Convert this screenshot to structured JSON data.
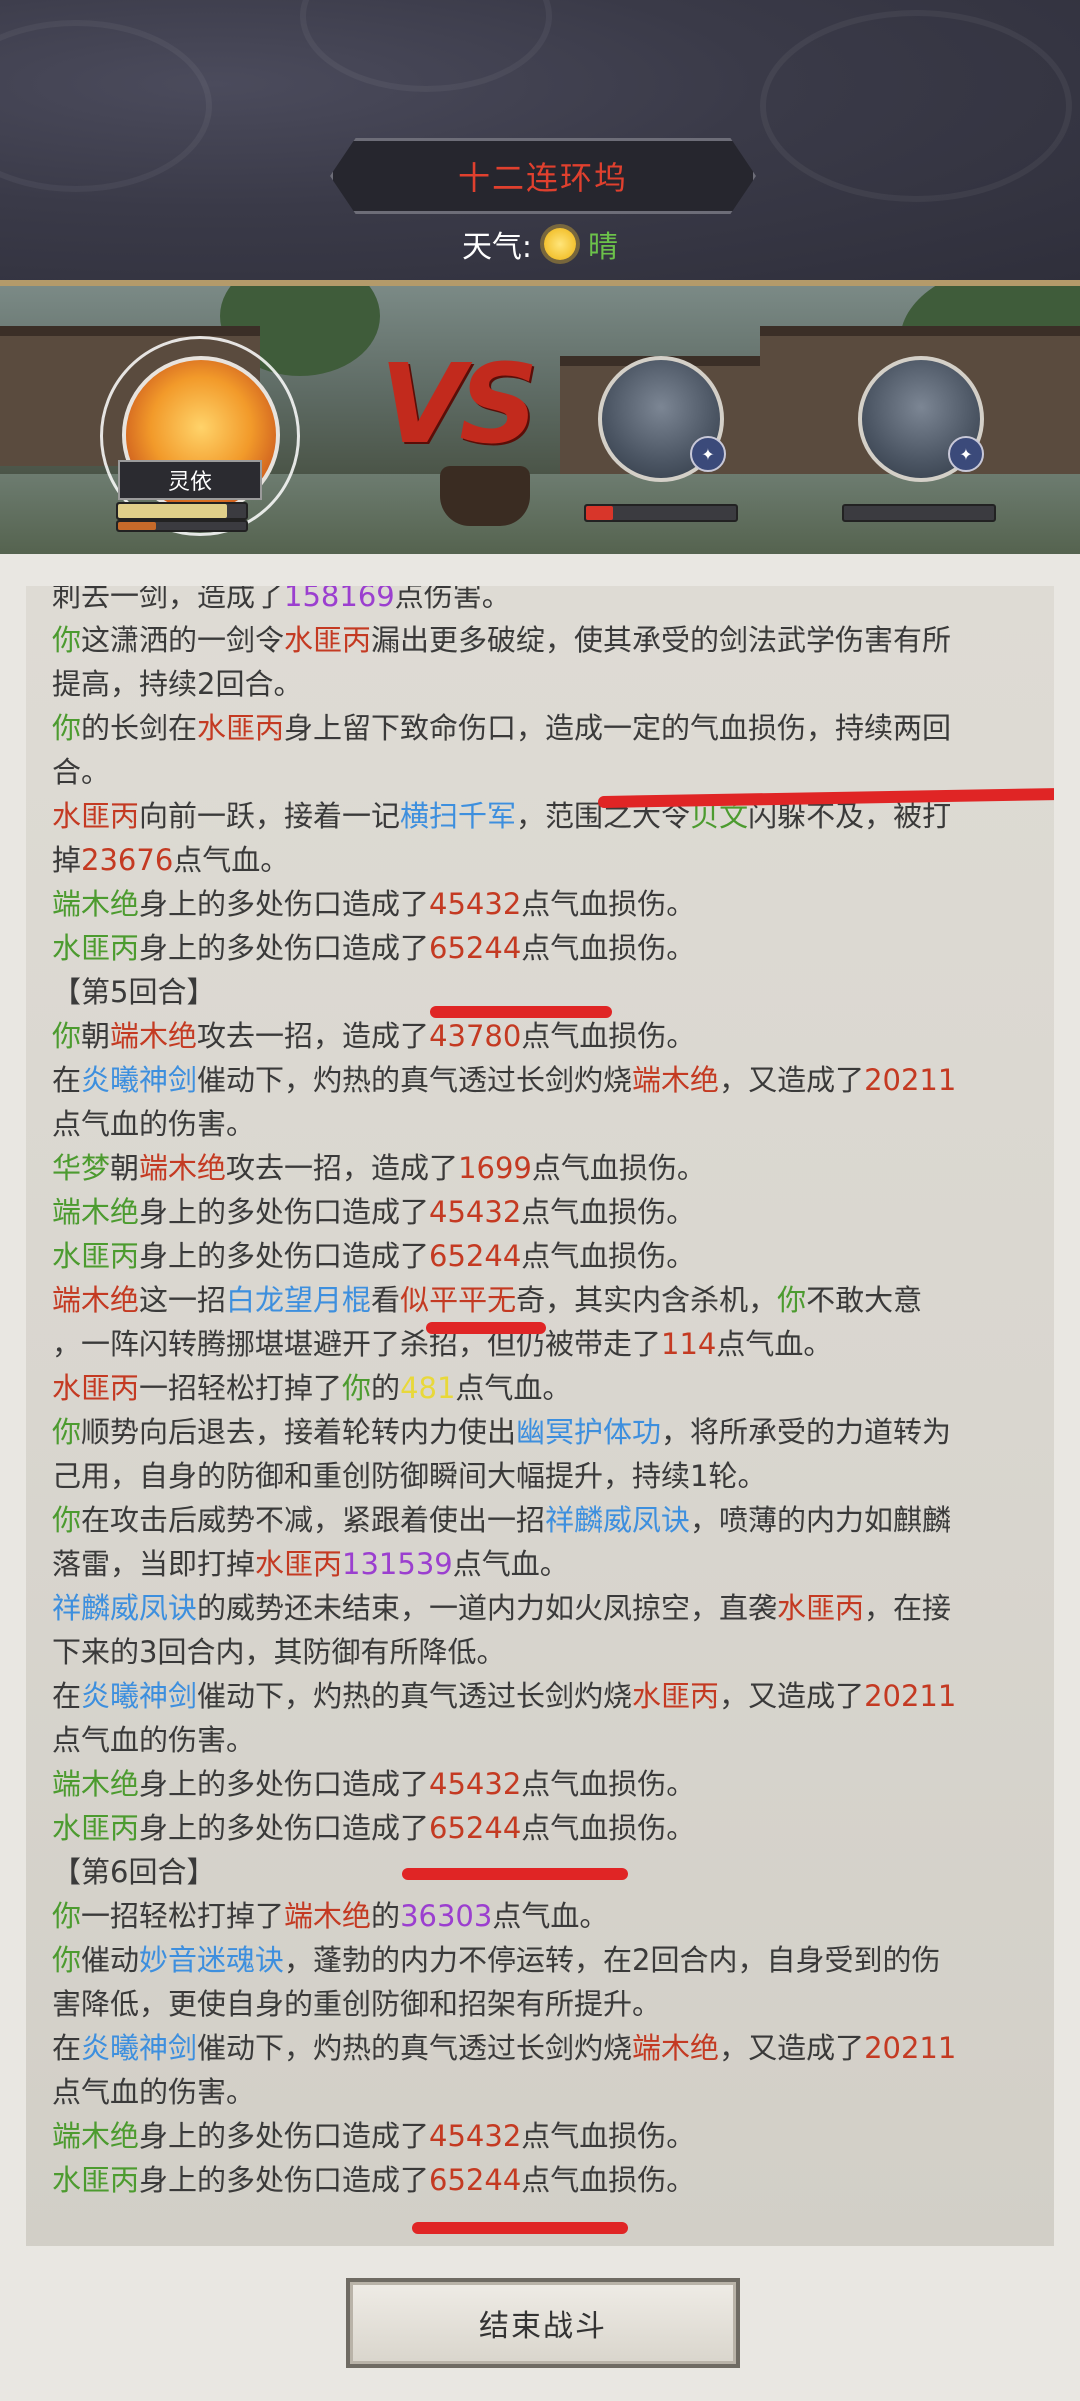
{
  "header": {
    "location_title": "十二连环坞",
    "weather_label": "天气:",
    "weather_icon": "sun-icon",
    "weather_value": "晴"
  },
  "battle": {
    "player_name": "灵依",
    "vs_text": "VS",
    "player_hp_fraction": 0.85,
    "enemy1_hp_fraction": 0.18,
    "enemy2_hp_fraction": 0.0
  },
  "log": {
    "lines": [
      [
        {
          "t": "刺去一剑，造成了",
          "c": "dk"
        },
        {
          "t": "158169",
          "c": "p"
        },
        {
          "t": "点伤害。",
          "c": "dk"
        }
      ],
      [
        {
          "t": "你",
          "c": "g"
        },
        {
          "t": "这潇洒的一剑令",
          "c": "dk"
        },
        {
          "t": "水匪丙",
          "c": "r"
        },
        {
          "t": "漏出更多破绽，使其承受的剑法武学伤害有所",
          "c": "dk"
        }
      ],
      [
        {
          "t": "提高，持续2回合。",
          "c": "dk"
        }
      ],
      [
        {
          "t": "你",
          "c": "g"
        },
        {
          "t": "的长剑在",
          "c": "dk"
        },
        {
          "t": "水匪丙",
          "c": "r"
        },
        {
          "t": "身上留下致命伤口，造成一定的气血损伤，持续两回",
          "c": "dk"
        }
      ],
      [
        {
          "t": "合。",
          "c": "dk"
        }
      ],
      [
        {
          "t": "水匪丙",
          "c": "r"
        },
        {
          "t": "向前一跃，接着一记",
          "c": "dk"
        },
        {
          "t": "横扫千军",
          "c": "b"
        },
        {
          "t": "，范围之大令",
          "c": "dk"
        },
        {
          "t": "贝文",
          "c": "g"
        },
        {
          "t": "闪躲不及，被打",
          "c": "dk"
        }
      ],
      [
        {
          "t": "掉",
          "c": "dk"
        },
        {
          "t": "23676",
          "c": "r"
        },
        {
          "t": "点气血。",
          "c": "dk"
        }
      ],
      [
        {
          "t": "端木绝",
          "c": "g"
        },
        {
          "t": "身上的多处伤口造成了",
          "c": "dk"
        },
        {
          "t": "45432",
          "c": "r"
        },
        {
          "t": "点气血损伤。",
          "c": "dk"
        }
      ],
      [
        {
          "t": "水匪丙",
          "c": "g"
        },
        {
          "t": "身上的多处伤口造成了",
          "c": "dk"
        },
        {
          "t": "65244",
          "c": "r"
        },
        {
          "t": "点气血损伤。",
          "c": "dk"
        }
      ],
      [
        {
          "t": "【第5回合】",
          "c": "dk"
        }
      ],
      [
        {
          "t": "你",
          "c": "g"
        },
        {
          "t": "朝",
          "c": "dk"
        },
        {
          "t": "端木绝",
          "c": "r"
        },
        {
          "t": "攻去一招，造成了",
          "c": "dk"
        },
        {
          "t": "43780",
          "c": "r"
        },
        {
          "t": "点气血损伤。",
          "c": "dk"
        }
      ],
      [
        {
          "t": "在",
          "c": "dk"
        },
        {
          "t": "炎曦神剑",
          "c": "b"
        },
        {
          "t": "催动下，灼热的真气透过长剑灼烧",
          "c": "dk"
        },
        {
          "t": "端木绝",
          "c": "r"
        },
        {
          "t": "，又造成了",
          "c": "dk"
        },
        {
          "t": "20211",
          "c": "r"
        }
      ],
      [
        {
          "t": "点气血的伤害。",
          "c": "dk"
        }
      ],
      [
        {
          "t": "华梦",
          "c": "g"
        },
        {
          "t": "朝",
          "c": "dk"
        },
        {
          "t": "端木绝",
          "c": "r"
        },
        {
          "t": "攻去一招，造成了",
          "c": "dk"
        },
        {
          "t": "1699",
          "c": "r"
        },
        {
          "t": "点气血损伤。",
          "c": "dk"
        }
      ],
      [
        {
          "t": "端木绝",
          "c": "g"
        },
        {
          "t": "身上的多处伤口造成了",
          "c": "dk"
        },
        {
          "t": "45432",
          "c": "r"
        },
        {
          "t": "点气血损伤。",
          "c": "dk"
        }
      ],
      [
        {
          "t": "水匪丙",
          "c": "g"
        },
        {
          "t": "身上的多处伤口造成了",
          "c": "dk"
        },
        {
          "t": "65244",
          "c": "r"
        },
        {
          "t": "点气血损伤。",
          "c": "dk"
        }
      ],
      [
        {
          "t": "端木绝",
          "c": "r"
        },
        {
          "t": "这一招",
          "c": "dk"
        },
        {
          "t": "白龙望月棍",
          "c": "b"
        },
        {
          "t": "看",
          "c": "dk"
        },
        {
          "t": "似平平无",
          "c": "r"
        },
        {
          "t": "奇，其实内含杀机，",
          "c": "dk"
        },
        {
          "t": "你",
          "c": "g"
        },
        {
          "t": "不敢大意",
          "c": "dk"
        }
      ],
      [
        {
          "t": "，一阵闪转腾挪堪堪避开了杀招，但仍被带走了",
          "c": "dk"
        },
        {
          "t": "114",
          "c": "r"
        },
        {
          "t": "点气血。",
          "c": "dk"
        }
      ],
      [
        {
          "t": "水匪丙",
          "c": "r"
        },
        {
          "t": "一招轻松打掉了",
          "c": "dk"
        },
        {
          "t": "你",
          "c": "g"
        },
        {
          "t": "的",
          "c": "dk"
        },
        {
          "t": "481",
          "c": "y"
        },
        {
          "t": "点气血。",
          "c": "dk"
        }
      ],
      [
        {
          "t": "你",
          "c": "g"
        },
        {
          "t": "顺势向后退去，接着轮转内力使出",
          "c": "dk"
        },
        {
          "t": "幽冥护体功",
          "c": "b"
        },
        {
          "t": "，将所承受的力道转为",
          "c": "dk"
        }
      ],
      [
        {
          "t": "己用，自身的防御和重创防御瞬间大幅提升，持续1轮。",
          "c": "dk"
        }
      ],
      [
        {
          "t": "你",
          "c": "g"
        },
        {
          "t": "在攻击后威势不减，紧跟着使出一招",
          "c": "dk"
        },
        {
          "t": "祥麟威凤诀",
          "c": "b"
        },
        {
          "t": "，喷薄的内力如麒麟",
          "c": "dk"
        }
      ],
      [
        {
          "t": "落雷，当即打掉",
          "c": "dk"
        },
        {
          "t": "水匪丙",
          "c": "r"
        },
        {
          "t": "131539",
          "c": "p"
        },
        {
          "t": "点气血。",
          "c": "dk"
        }
      ],
      [
        {
          "t": "祥麟威凤诀",
          "c": "b"
        },
        {
          "t": "的威势还未结束，一道内力如火凤掠空，直袭",
          "c": "dk"
        },
        {
          "t": "水匪丙",
          "c": "r"
        },
        {
          "t": "，在接",
          "c": "dk"
        }
      ],
      [
        {
          "t": "下来的3回合内，其防御有所降低。",
          "c": "dk"
        }
      ],
      [
        {
          "t": "在",
          "c": "dk"
        },
        {
          "t": "炎曦神剑",
          "c": "b"
        },
        {
          "t": "催动下，灼热的真气透过长剑灼烧",
          "c": "dk"
        },
        {
          "t": "水匪丙",
          "c": "r"
        },
        {
          "t": "，又造成了",
          "c": "dk"
        },
        {
          "t": "20211",
          "c": "r"
        }
      ],
      [
        {
          "t": "点气血的伤害。",
          "c": "dk"
        }
      ],
      [
        {
          "t": "端木绝",
          "c": "g"
        },
        {
          "t": "身上的多处伤口造成了",
          "c": "dk"
        },
        {
          "t": "45432",
          "c": "r"
        },
        {
          "t": "点气血损伤。",
          "c": "dk"
        }
      ],
      [
        {
          "t": "水匪丙",
          "c": "g"
        },
        {
          "t": "身上的多处伤口造成了",
          "c": "dk"
        },
        {
          "t": "65244",
          "c": "r"
        },
        {
          "t": "点气血损伤。",
          "c": "dk"
        }
      ],
      [
        {
          "t": "【第6回合】",
          "c": "dk"
        }
      ],
      [
        {
          "t": "你",
          "c": "g"
        },
        {
          "t": "一招轻松打掉了",
          "c": "dk"
        },
        {
          "t": "端木绝",
          "c": "r"
        },
        {
          "t": "的",
          "c": "dk"
        },
        {
          "t": "36303",
          "c": "p"
        },
        {
          "t": "点气血。",
          "c": "dk"
        }
      ],
      [
        {
          "t": "你",
          "c": "g"
        },
        {
          "t": "催动",
          "c": "dk"
        },
        {
          "t": "妙音迷魂诀",
          "c": "b"
        },
        {
          "t": "，蓬勃的内力不停运转，在2回合内，自身受到的伤",
          "c": "dk"
        }
      ],
      [
        {
          "t": "害降低，更使自身的重创防御和招架有所提升。",
          "c": "dk"
        }
      ],
      [
        {
          "t": "在",
          "c": "dk"
        },
        {
          "t": "炎曦神剑",
          "c": "b"
        },
        {
          "t": "催动下，灼热的真气透过长剑灼烧",
          "c": "dk"
        },
        {
          "t": "端木绝",
          "c": "r"
        },
        {
          "t": "，又造成了",
          "c": "dk"
        },
        {
          "t": "20211",
          "c": "r"
        }
      ],
      [
        {
          "t": "点气血的伤害。",
          "c": "dk"
        }
      ],
      [
        {
          "t": "端木绝",
          "c": "g"
        },
        {
          "t": "身上的多处伤口造成了",
          "c": "dk"
        },
        {
          "t": "45432",
          "c": "r"
        },
        {
          "t": "点气血损伤。",
          "c": "dk"
        }
      ],
      [
        {
          "t": "水匪丙",
          "c": "g"
        },
        {
          "t": "身上的多处伤口造成了",
          "c": "dk"
        },
        {
          "t": "65244",
          "c": "r"
        },
        {
          "t": "点气血损伤。",
          "c": "dk"
        }
      ]
    ]
  },
  "footer": {
    "end_battle_label": "结束战斗"
  },
  "colors": {
    "accent_red": "#c43a22",
    "green_name": "#4c9b2f",
    "skill_blue": "#3d8fde",
    "crit_purple": "#9b3fcf",
    "annotation_red": "#e02525"
  }
}
